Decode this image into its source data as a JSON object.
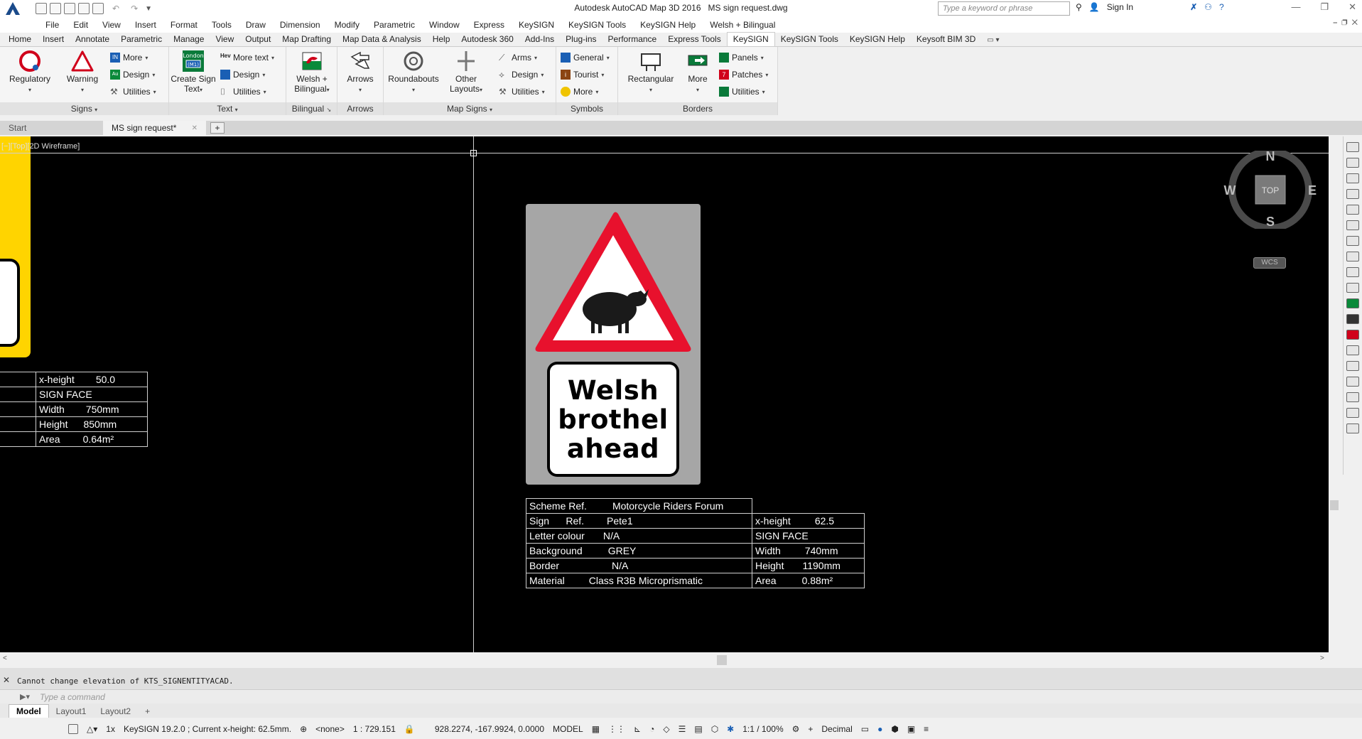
{
  "app": {
    "logo_text": "M3D",
    "title": "Autodesk AutoCAD Map 3D 2016",
    "document_name": "MS sign request.dwg",
    "search_placeholder": "Type a keyword or phrase",
    "sign_in": "Sign In"
  },
  "menu": [
    "File",
    "Edit",
    "View",
    "Insert",
    "Format",
    "Tools",
    "Draw",
    "Dimension",
    "Modify",
    "Parametric",
    "Window",
    "Express",
    "KeySIGN",
    "KeySIGN Tools",
    "KeySIGN Help",
    "Welsh + Bilingual"
  ],
  "ribbon_tabs": [
    "Home",
    "Insert",
    "Annotate",
    "Parametric",
    "Manage",
    "View",
    "Output",
    "Map Drafting",
    "Map Data & Analysis",
    "Help",
    "Autodesk 360",
    "Add-Ins",
    "Plug-ins",
    "Performance",
    "Express Tools",
    "KeySIGN",
    "KeySIGN Tools",
    "KeySIGN Help",
    "Keysoft BIM 3D"
  ],
  "active_ribbon_tab": "KeySIGN",
  "ribbon": {
    "signs": {
      "title": "Signs",
      "regulatory": "Regulatory",
      "warning": "Warning",
      "more": "More",
      "design": "Design",
      "utilities": "Utilities"
    },
    "text": {
      "title": "Text",
      "create_sign_text": "Create Sign Text",
      "more_text": "More text",
      "design": "Design",
      "utilities": "Utilities"
    },
    "bilingual": {
      "title": "Bilingual",
      "welsh_bilingual": "Welsh + Bilingual"
    },
    "arrows": {
      "title": "Arrows",
      "arrows": "Arrows"
    },
    "map_signs": {
      "title": "Map Signs",
      "roundabouts": "Roundabouts",
      "other_layouts": "Other Layouts",
      "arms": "Arms",
      "design": "Design",
      "utilities": "Utilities"
    },
    "symbols": {
      "title": "Symbols",
      "general": "General",
      "tourist": "Tourist",
      "more": "More"
    },
    "borders": {
      "title": "Borders",
      "rectangular": "Rectangular",
      "more": "More",
      "panels": "Panels",
      "patches": "Patches",
      "utilities": "Utilities"
    }
  },
  "doc_tabs": {
    "start": "Start",
    "active": "MS sign request*",
    "close": "✕",
    "add": "+"
  },
  "viewport": {
    "label": "[−][Top][2D Wireframe]",
    "compass": {
      "n": "N",
      "s": "S",
      "e": "E",
      "w": "W",
      "top": "TOP"
    },
    "wcs": "WCS"
  },
  "left_table": {
    "rows": [
      {
        "label": "x-height",
        "value": "50.0"
      },
      {
        "label": "SIGN FACE",
        "value": ""
      },
      {
        "label": "Width",
        "value": "750mm"
      },
      {
        "label": "Height",
        "value": "850mm"
      },
      {
        "label": "Area",
        "value": "0.64m²"
      }
    ]
  },
  "sign": {
    "line1": "Welsh",
    "line2": "brothel",
    "line3": "ahead",
    "colors": {
      "red": "#e8112d",
      "panel": "#a6a6a6"
    }
  },
  "info_table": {
    "scheme_ref_label": "Scheme Ref.",
    "scheme_ref": "Motorcycle Riders Forum",
    "sign_ref_label": "Sign      Ref.",
    "sign_ref": "Pete1",
    "letter_colour_label": "Letter colour",
    "letter_colour": "N/A",
    "background_label": "Background",
    "background": "GREY",
    "border_label": "Border",
    "border": "N/A",
    "material_label": "Material",
    "material": "Class R3B Microprismatic",
    "xheight_label": "x-height",
    "xheight": "62.5",
    "sign_face": "SIGN FACE",
    "width_label": "Width",
    "width": "740mm",
    "height_label": "Height",
    "height": "1190mm",
    "area_label": "Area",
    "area": "0.88m²"
  },
  "command": {
    "history": "Cannot change elevation of KTS_SIGNENTITYACAD.",
    "placeholder": "Type a command"
  },
  "layout_tabs": [
    "Model",
    "Layout1",
    "Layout2"
  ],
  "status": {
    "scale_1x": "1x",
    "keysign": "KeySIGN 19.2.0 ;  Current x-height: 62.5mm.",
    "none": "<none>",
    "scale": "1 : 729.151",
    "coords": "928.2274, -167.9924, 0.0000",
    "model": "MODEL",
    "annoscale": "1:1 / 100%",
    "units": "Decimal"
  }
}
